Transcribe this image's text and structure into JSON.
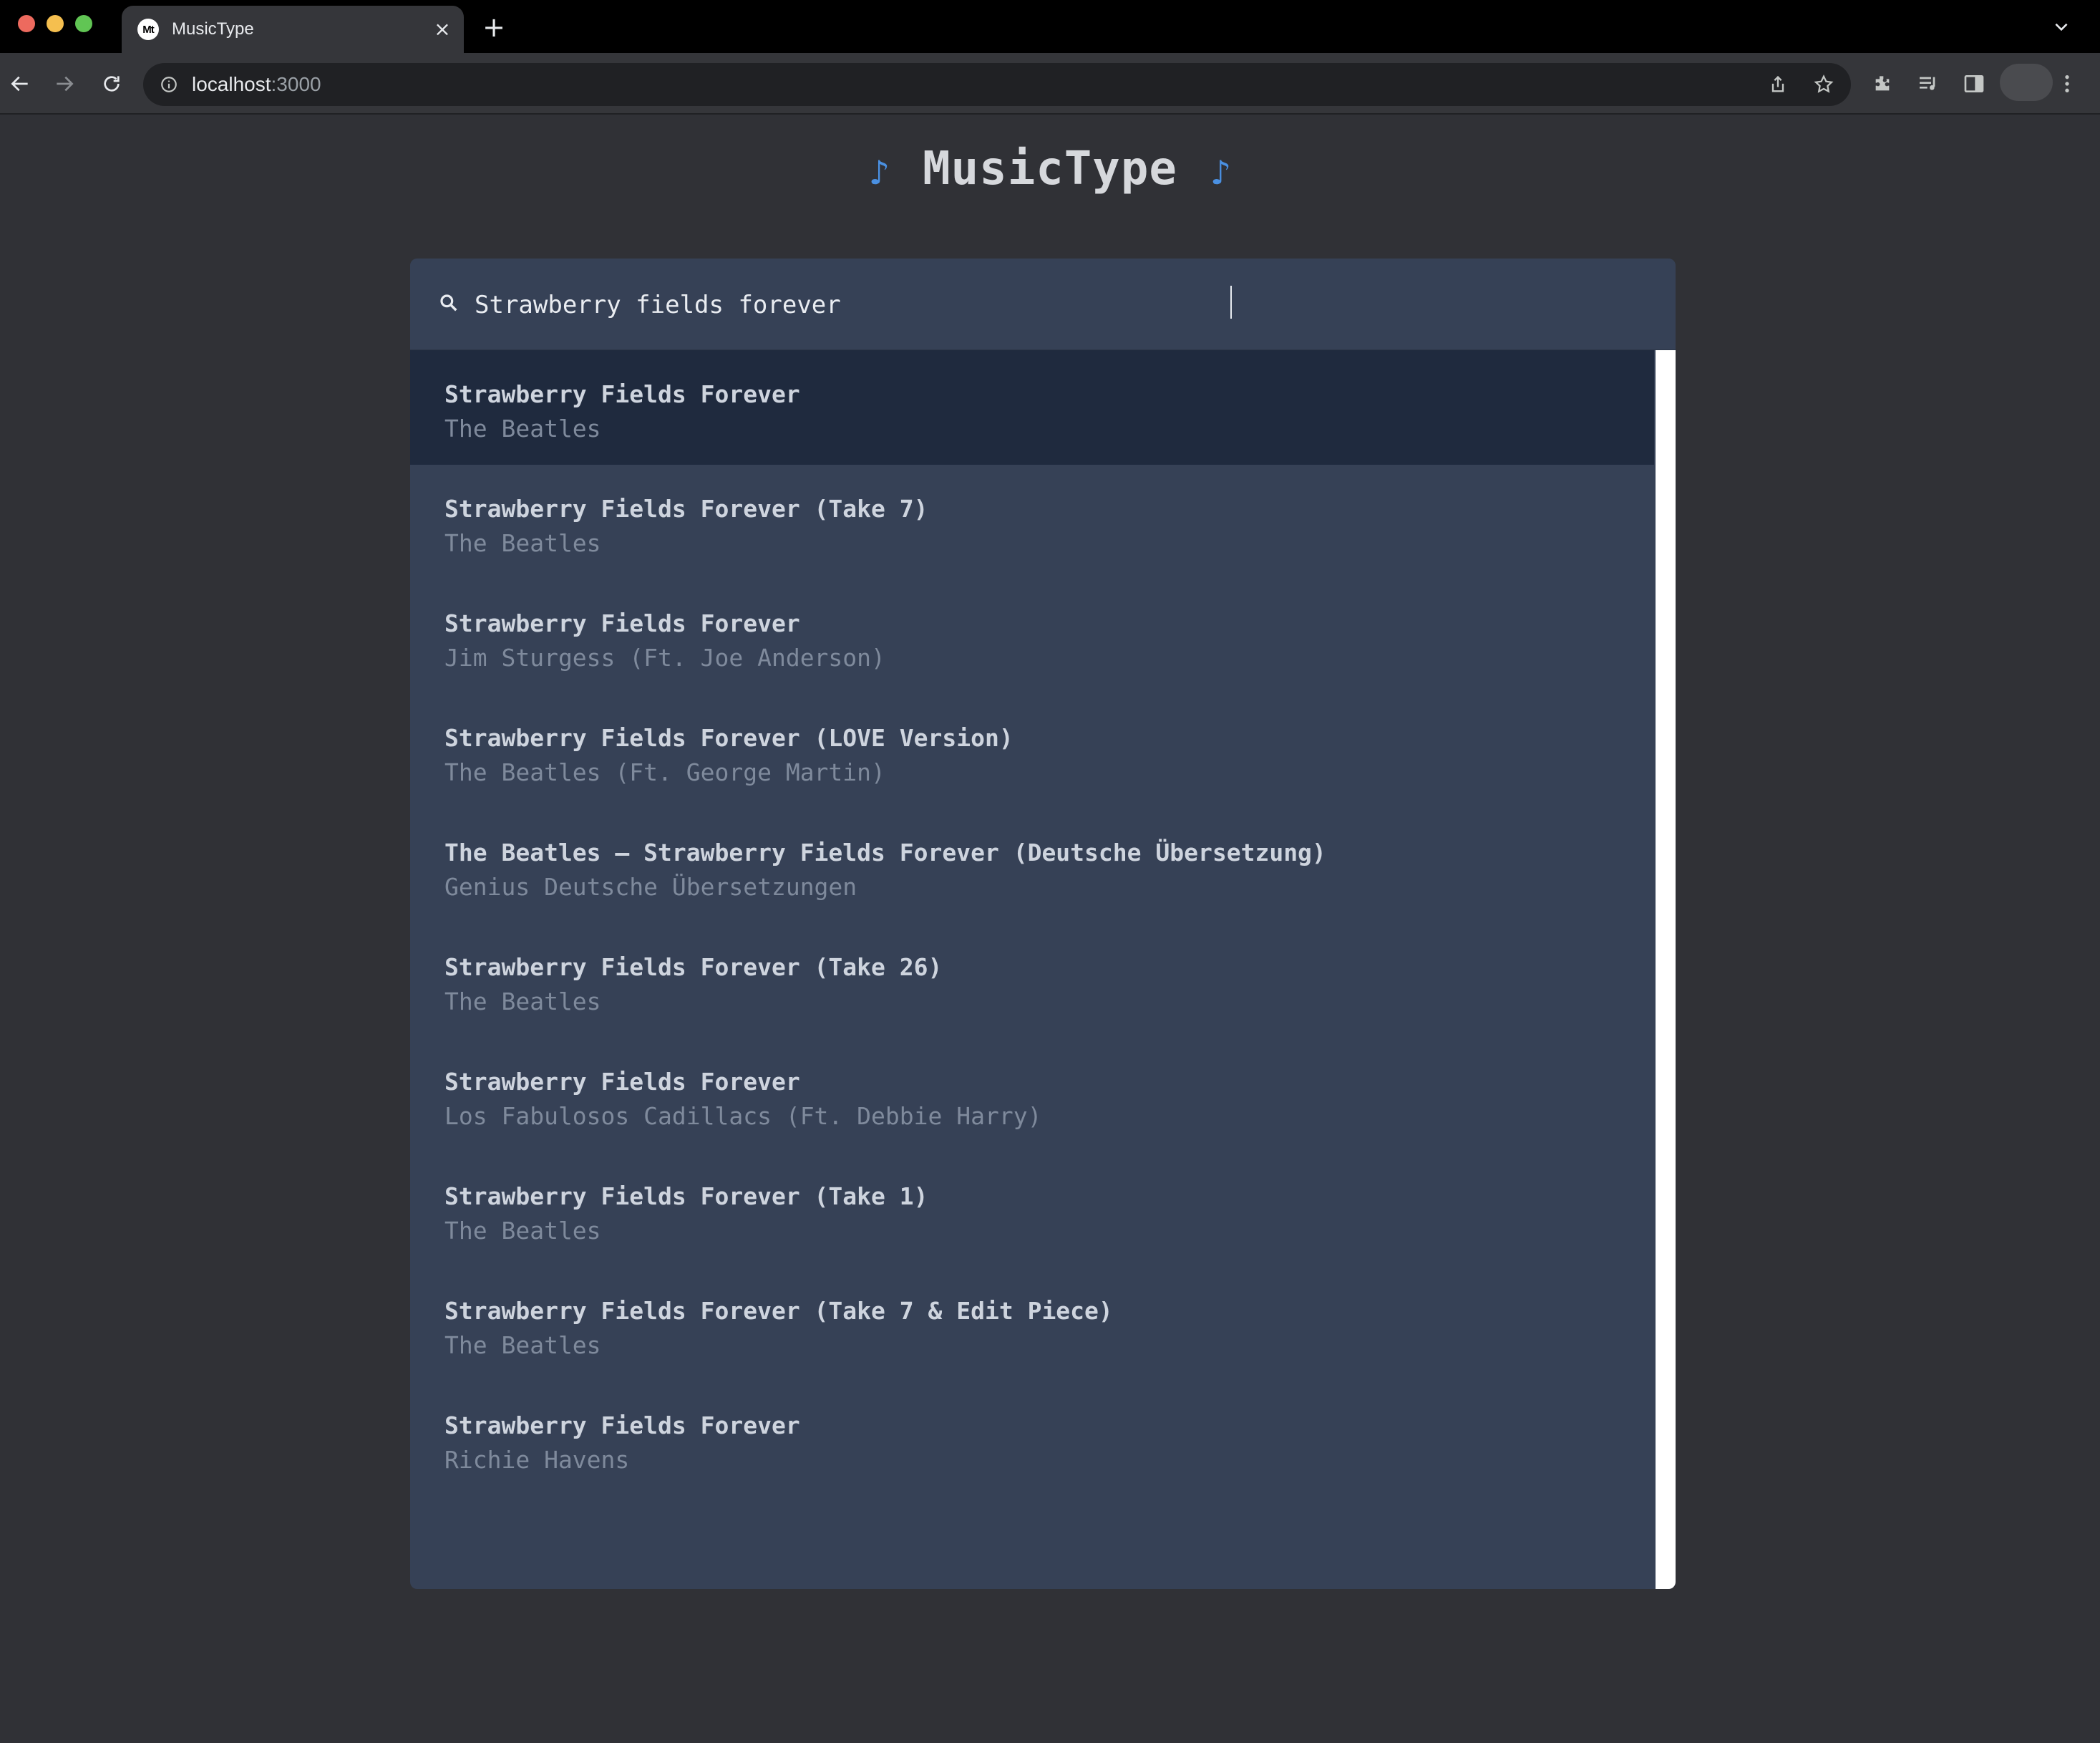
{
  "browser": {
    "tab_title": "MusicType",
    "tab_favicon_text": "Mt",
    "url_host": "localhost",
    "url_port": ":3000"
  },
  "app": {
    "title": "MusicType",
    "note_left": "♪",
    "note_right": "♪",
    "accent_color": "#4a90e2"
  },
  "search": {
    "value": "Strawberry fields forever",
    "icon": "search-icon"
  },
  "results": [
    {
      "title": "Strawberry Fields Forever",
      "artist": "The Beatles",
      "selected": true
    },
    {
      "title": "Strawberry Fields Forever (Take 7)",
      "artist": "The Beatles"
    },
    {
      "title": "Strawberry Fields Forever",
      "artist": "Jim Sturgess (Ft. Joe Anderson)"
    },
    {
      "title": "Strawberry Fields Forever (LOVE Version)",
      "artist": "The Beatles (Ft. George Martin)"
    },
    {
      "title": "The Beatles – Strawberry Fields Forever (Deutsche Übersetzung)",
      "artist": "Genius Deutsche Übersetzungen"
    },
    {
      "title": "Strawberry Fields Forever (Take 26)",
      "artist": "The Beatles"
    },
    {
      "title": "Strawberry Fields Forever",
      "artist": "Los Fabulosos Cadillacs (Ft. Debbie Harry)"
    },
    {
      "title": "Strawberry Fields Forever (Take 1)",
      "artist": "The Beatles"
    },
    {
      "title": "Strawberry Fields Forever (Take 7 & Edit Piece)",
      "artist": "The Beatles"
    },
    {
      "title": "Strawberry Fields Forever",
      "artist": "Richie Havens"
    }
  ]
}
